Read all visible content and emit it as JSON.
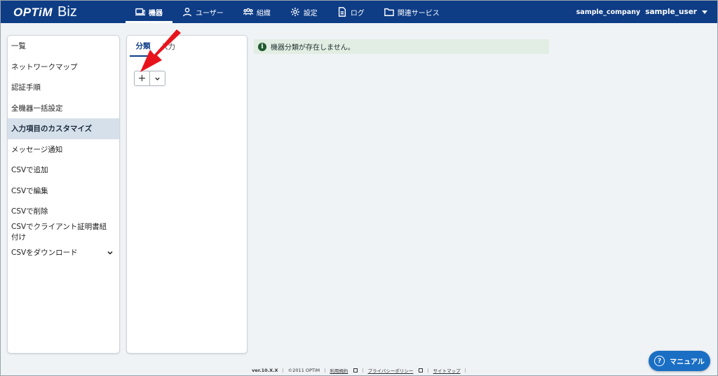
{
  "header": {
    "logo_main": "OPTiM",
    "logo_sub": "Biz",
    "nav": [
      {
        "label": "機器",
        "icon": "device-icon",
        "active": true
      },
      {
        "label": "ユーザー",
        "icon": "user-icon",
        "active": false
      },
      {
        "label": "組織",
        "icon": "group-icon",
        "active": false
      },
      {
        "label": "設定",
        "icon": "gear-icon",
        "active": false
      },
      {
        "label": "ログ",
        "icon": "document-icon",
        "active": false
      },
      {
        "label": "関連サービス",
        "icon": "folder-icon",
        "active": false
      }
    ],
    "company": "sample_company",
    "user": "sample_user"
  },
  "sidebar": {
    "items": [
      {
        "label": "一覧"
      },
      {
        "label": "ネットワークマップ"
      },
      {
        "label": "認証手順"
      },
      {
        "label": "全機器一括設定"
      },
      {
        "label": "入力項目のカスタマイズ",
        "active": true
      },
      {
        "label": "メッセージ通知"
      },
      {
        "label": "CSVで追加"
      },
      {
        "label": "CSVで編集"
      },
      {
        "label": "CSVで削除"
      },
      {
        "label": "CSVでクライアント証明書紐付け"
      },
      {
        "label": "CSVをダウンロード",
        "expandable": true
      }
    ]
  },
  "panel": {
    "tabs": [
      {
        "label": "分類",
        "active": true
      },
      {
        "label": "入力"
      }
    ],
    "add_label": "+"
  },
  "alert": {
    "icon_glyph": "i",
    "message": "機器分類が存在しません。"
  },
  "footer": {
    "version": "ver.10.X.X",
    "copyright": "©2011 OPTiM",
    "links": [
      "利用規約",
      "プライバシーポリシー",
      "サイトマップ"
    ]
  },
  "manual_button": {
    "label": "マニュアル",
    "icon_glyph": "?"
  },
  "colors": {
    "header_bg": "#0e3d86",
    "active_item_bg": "#d6e0ea",
    "alert_bg": "#e2ede3",
    "manual_bg": "#1a6fc4",
    "annotation_arrow": "#e8141b"
  }
}
